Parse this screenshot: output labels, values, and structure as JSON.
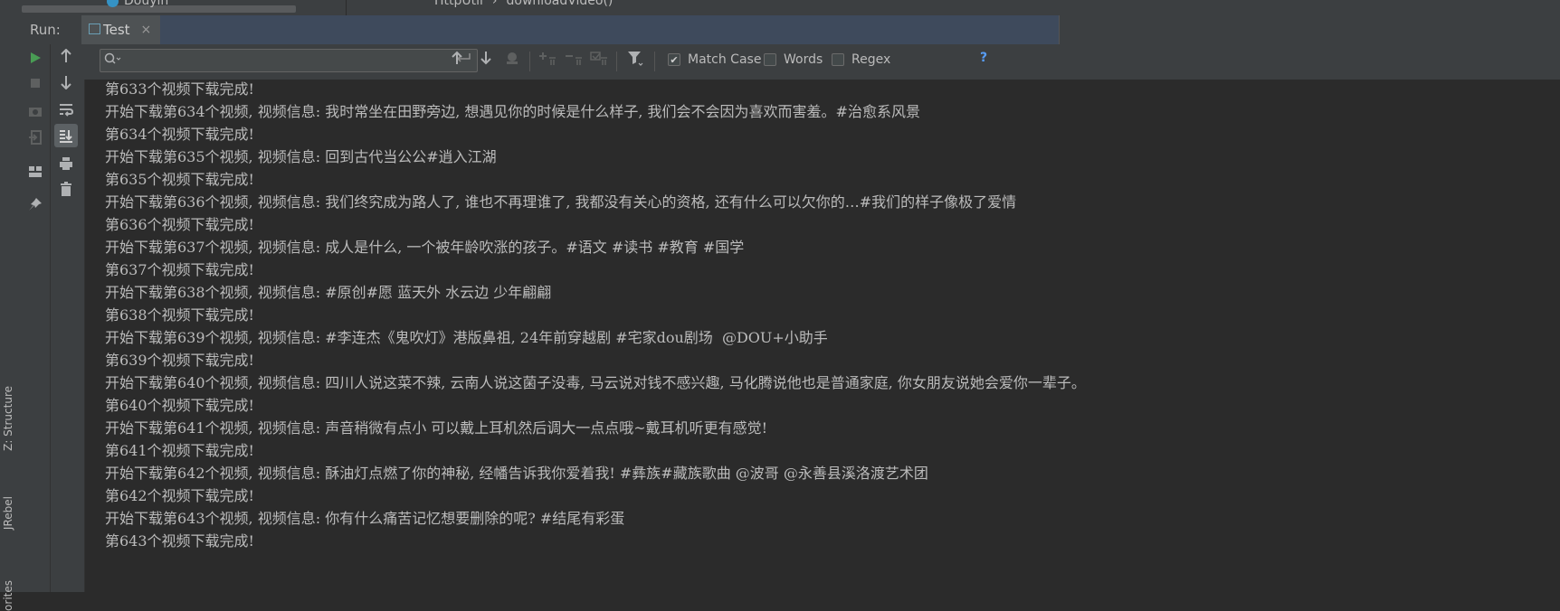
{
  "editor": {
    "project_name": "Douyin",
    "breadcrumb": [
      "HttpUtil",
      "›",
      "downloadVideo()"
    ]
  },
  "left_strip": {
    "tabs": [
      "Z: Structure",
      "JRebel",
      "orites"
    ]
  },
  "run_panel": {
    "label": "Run:",
    "tab_title": "Test",
    "tab_close": "×"
  },
  "icons": {
    "run": "play-icon",
    "stop": "stop-icon",
    "dump": "camera-icon",
    "exit": "exit-icon",
    "layout": "layout-icon",
    "pin": "pin-icon",
    "up": "arrow-up-icon",
    "down": "arrow-down-icon",
    "wrap": "soft-wrap-icon",
    "scroll_end": "scroll-to-end-icon",
    "print": "print-icon",
    "trash": "trash-icon"
  },
  "search": {
    "placeholder": "",
    "value": "",
    "match_case_label": "Match Case",
    "match_case_checked": true,
    "words_label": "Words",
    "words_checked": false,
    "regex_label": "Regex",
    "regex_checked": false,
    "help": "?"
  },
  "colors": {
    "background": "#2b2b2b",
    "text": "#bbbbbb",
    "run_green": "#499c54",
    "help_blue": "#589df6"
  },
  "console_lines": [
    "第633个视频下载完成!",
    "开始下载第634个视频, 视频信息: 我时常坐在田野旁边, 想遇见你的时候是什么样子, 我们会不会因为喜欢而害羞。#治愈系风景",
    "第634个视频下载完成!",
    "开始下载第635个视频, 视频信息: 回到古代当公公#逍入江湖",
    "第635个视频下载完成!",
    "开始下载第636个视频, 视频信息: 我们终究成为路人了, 谁也不再理谁了, 我都没有关心的资格, 还有什么可以欠你的…#我们的样子像极了爱情",
    "第636个视频下载完成!",
    "开始下载第637个视频, 视频信息: 成人是什么, 一个被年龄吹涨的孩子。#语文 #读书 #教育 #国学",
    "第637个视频下载完成!",
    "开始下载第638个视频, 视频信息: #原创#愿 蓝天外 水云边 少年翩翩",
    "第638个视频下载完成!",
    "开始下载第639个视频, 视频信息: #李连杰《鬼吹灯》港版鼻祖, 24年前穿越剧 #宅家dou剧场  @DOU+小助手",
    "第639个视频下载完成!",
    "开始下载第640个视频, 视频信息: 四川人说这菜不辣, 云南人说这菌子没毒, 马云说对钱不感兴趣, 马化腾说他也是普通家庭, 你女朋友说她会爱你一辈子。",
    "第640个视频下载完成!",
    "开始下载第641个视频, 视频信息: 声音稍微有点小 可以戴上耳机然后调大一点点哦~戴耳机听更有感觉!",
    "第641个视频下载完成!",
    "开始下载第642个视频, 视频信息: 酥油灯点燃了你的神秘, 经幡告诉我你爱着我! #彝族#藏族歌曲 @波哥 @永善县溪洛渡艺术团",
    "第642个视频下载完成!",
    "开始下载第643个视频, 视频信息: 你有什么痛苦记忆想要删除的呢? #结尾有彩蛋",
    "第643个视频下载完成!"
  ]
}
